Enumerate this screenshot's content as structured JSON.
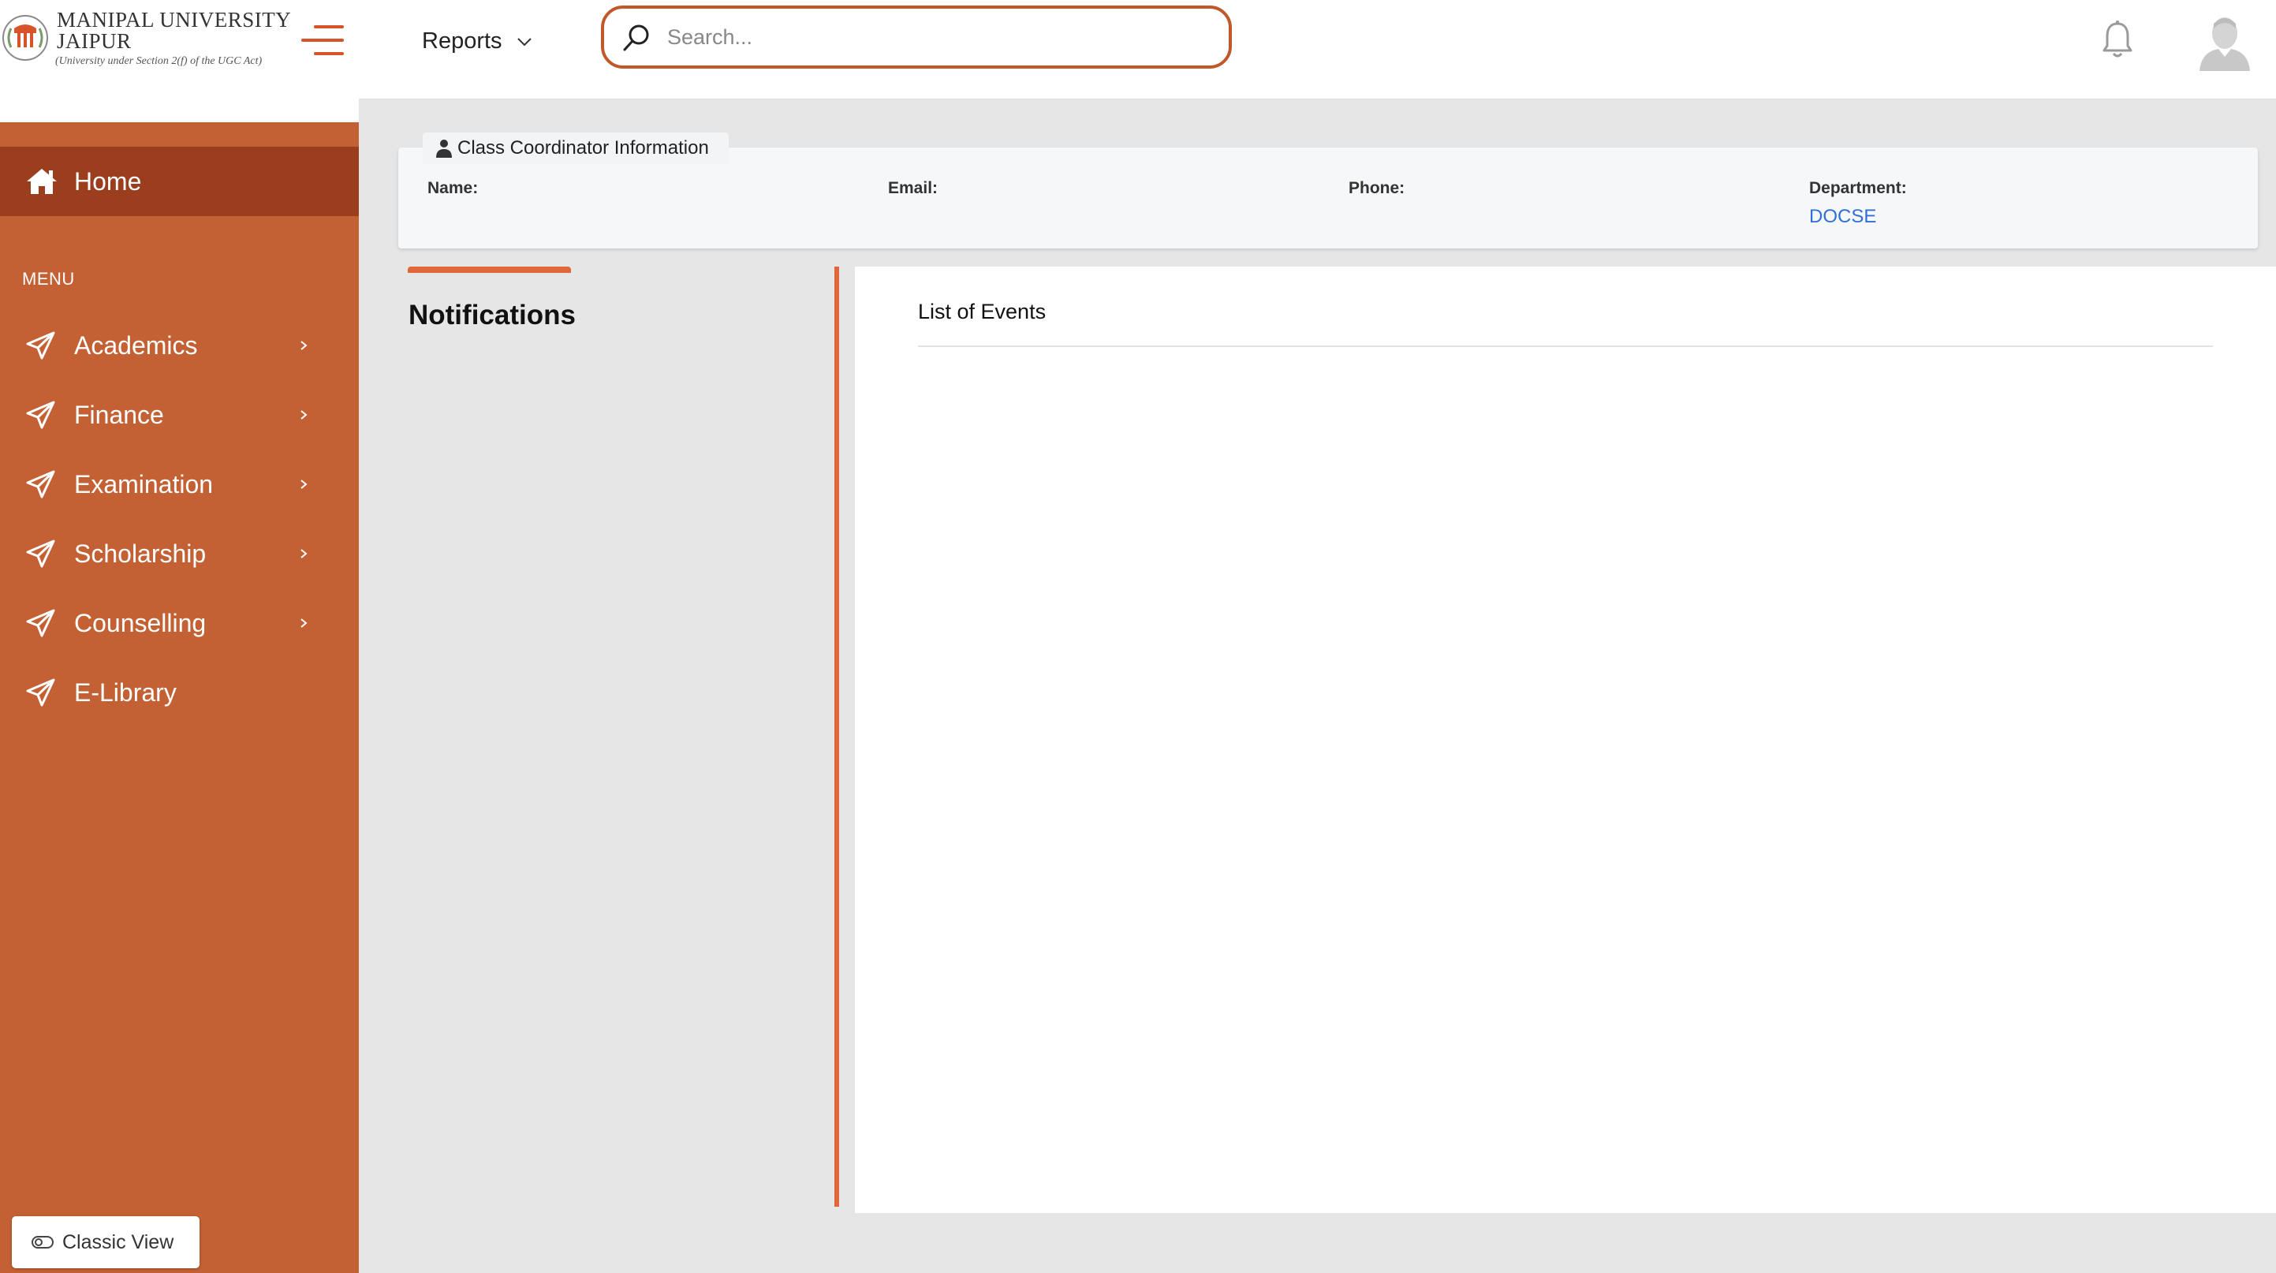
{
  "sidebar": {
    "logo": {
      "name_line1": "MANIPAL UNIVERSITY",
      "name_line2": "JAIPUR",
      "tagline": "(University under Section 2(f) of the UGC Act)"
    },
    "home_label": "Home",
    "menu_heading": "MENU",
    "items": [
      {
        "label": "Academics",
        "has_submenu": true,
        "icon": "paper-plane-icon"
      },
      {
        "label": "Finance",
        "has_submenu": true,
        "icon": "paper-plane-icon"
      },
      {
        "label": "Examination",
        "has_submenu": true,
        "icon": "paper-plane-icon"
      },
      {
        "label": "Scholarship",
        "has_submenu": true,
        "icon": "paper-plane-icon"
      },
      {
        "label": "Counselling",
        "has_submenu": true,
        "icon": "paper-plane-icon"
      },
      {
        "label": "E-Library",
        "has_submenu": false,
        "icon": "paper-plane-icon"
      }
    ],
    "classic_view_label": "Classic View"
  },
  "topbar": {
    "reports_label": "Reports",
    "search_placeholder": "Search..."
  },
  "coordinator": {
    "title": "Class Coordinator Information",
    "fields": {
      "name": {
        "label": "Name:",
        "value": ""
      },
      "email": {
        "label": "Email:",
        "value": ""
      },
      "phone": {
        "label": "Phone:",
        "value": ""
      },
      "department": {
        "label": "Department:",
        "value": "DOCSE"
      }
    }
  },
  "notifications": {
    "title": "Notifications"
  },
  "events": {
    "title": "List of Events"
  },
  "colors": {
    "sidebar": "#c36135",
    "sidebar_active": "#9b3e1e",
    "accent": "#e0673a",
    "link": "#2f6fd6"
  }
}
